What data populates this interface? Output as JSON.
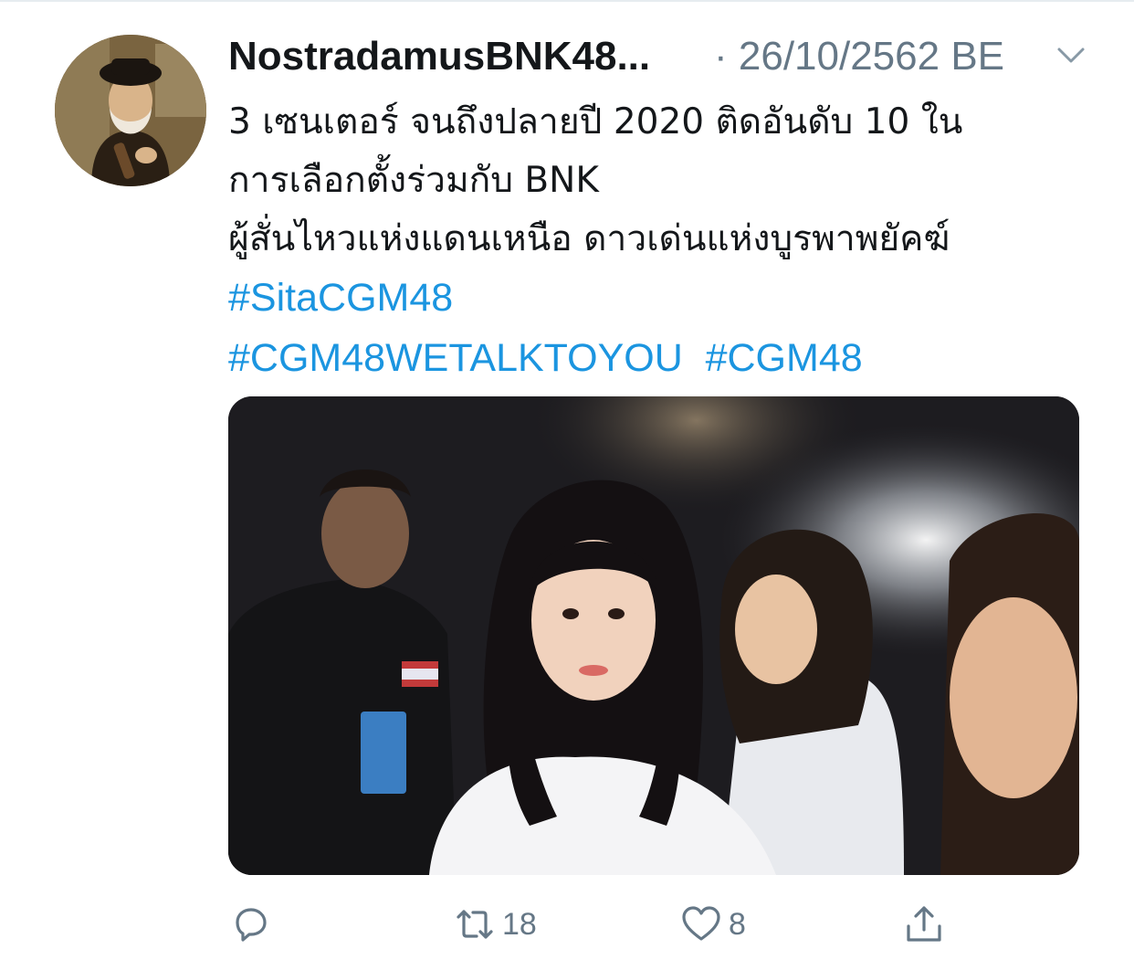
{
  "tweet": {
    "author_name": "NostradamusBNK48...",
    "timestamp": "· 26/10/2562 BE",
    "text_lines": [
      "3 เซนเตอร์ จนถึงปลายปี 2020 ติดอันดับ 10 ใน",
      "การเลือกตั้งร่วมกับ BNK",
      "ผู้สั่นไหวแห่งแดนเหนือ ดาวเด่นแห่งบูรพาพยัคฆ์"
    ],
    "hashtags": [
      "#SitaCGM48",
      "#CGM48WETALKTOYOU",
      "#CGM48"
    ],
    "retweet_count": "18",
    "like_count": "8"
  },
  "icons": {
    "caret": "chevron-down-icon",
    "reply": "reply-icon",
    "retweet": "retweet-icon",
    "like": "heart-icon",
    "share": "share-icon"
  },
  "colors": {
    "text": "#14171a",
    "secondary": "#657786",
    "link": "#1b95e0",
    "divider": "#e6ecf0"
  }
}
